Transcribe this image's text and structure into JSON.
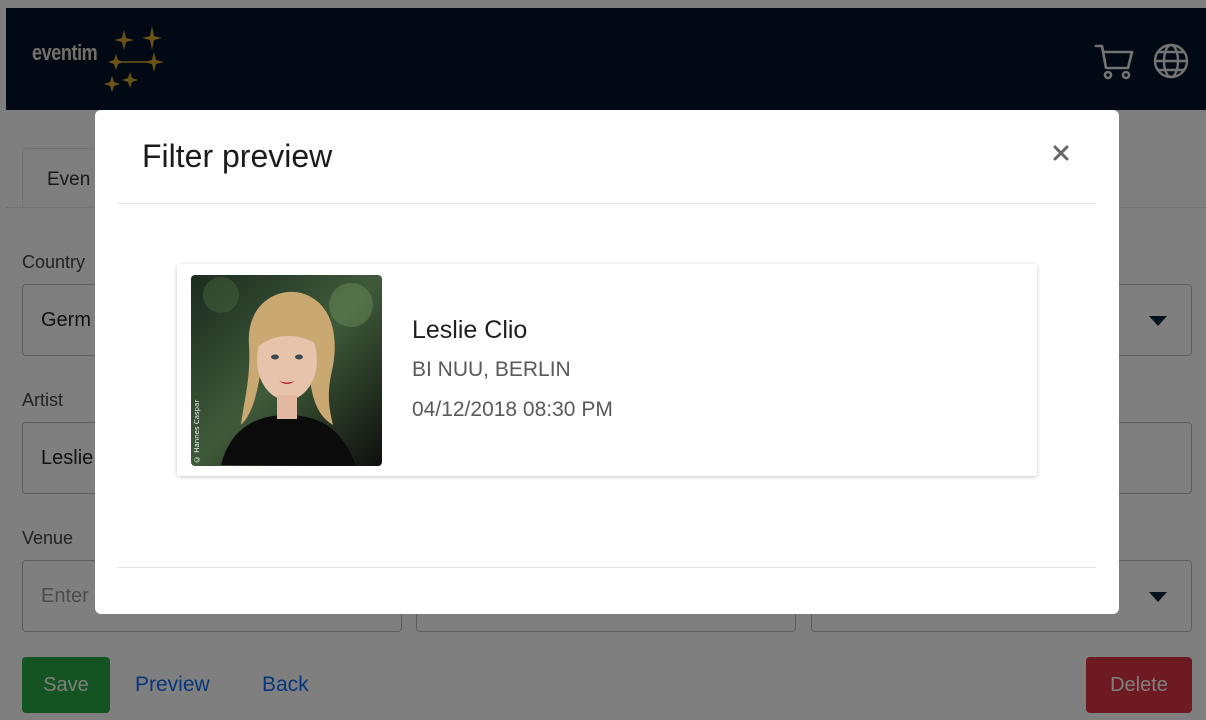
{
  "brand": {
    "logo_text": "eventim",
    "header_color": "#021428",
    "star_color": "#d9a72a"
  },
  "header": {
    "cart_icon": "cart-icon",
    "globe_icon": "globe-icon"
  },
  "form": {
    "tab_label": "Even",
    "country": {
      "label": "Country",
      "value": "Germ"
    },
    "artist": {
      "label": "Artist",
      "value": "Leslie"
    },
    "venue": {
      "label": "Venue",
      "placeholder": "Enter"
    },
    "save_label": "Save",
    "preview_label": "Preview",
    "back_label": "Back",
    "delete_label": "Delete"
  },
  "modal": {
    "title": "Filter preview",
    "close_label": "×",
    "event": {
      "artist": "Leslie Clio",
      "venue": "BI NUU, BERLIN",
      "datetime": "04/12/2018 08:30 PM",
      "photo_credit": "© Hannes Caspar"
    }
  },
  "colors": {
    "save": "#28a745",
    "delete": "#dc3545",
    "link": "#0d6efd"
  }
}
